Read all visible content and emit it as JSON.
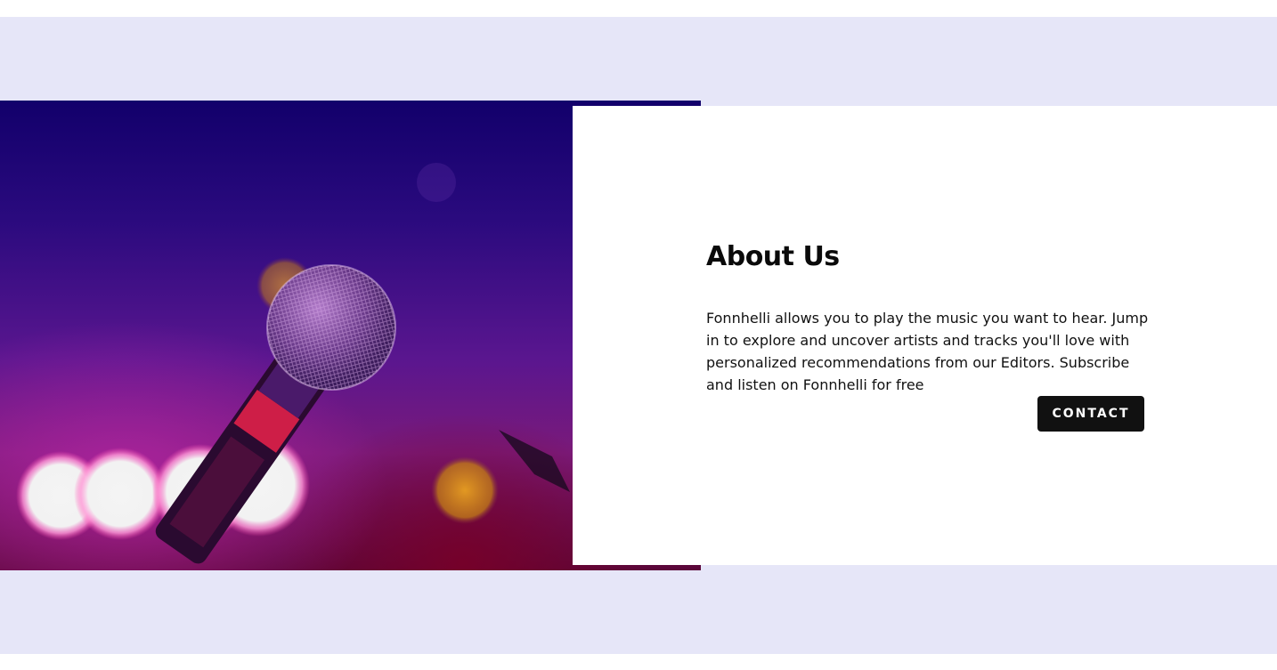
{
  "about": {
    "title": "About Us",
    "description": "Fonnhelli allows you to play the music you want to hear. Jump in to explore and uncover artists and tracks you'll love with personalized recommendations from our Editors. Subscribe and listen on Fonnhelli for free",
    "contact_label": "CONTACT"
  },
  "image": {
    "subject": "microphone-on-stage"
  },
  "colors": {
    "section_background": "#e6e6f8",
    "card_background": "#ffffff",
    "button_background": "#111111",
    "button_text": "#ffffff",
    "heading_text": "#0a0a0a"
  }
}
